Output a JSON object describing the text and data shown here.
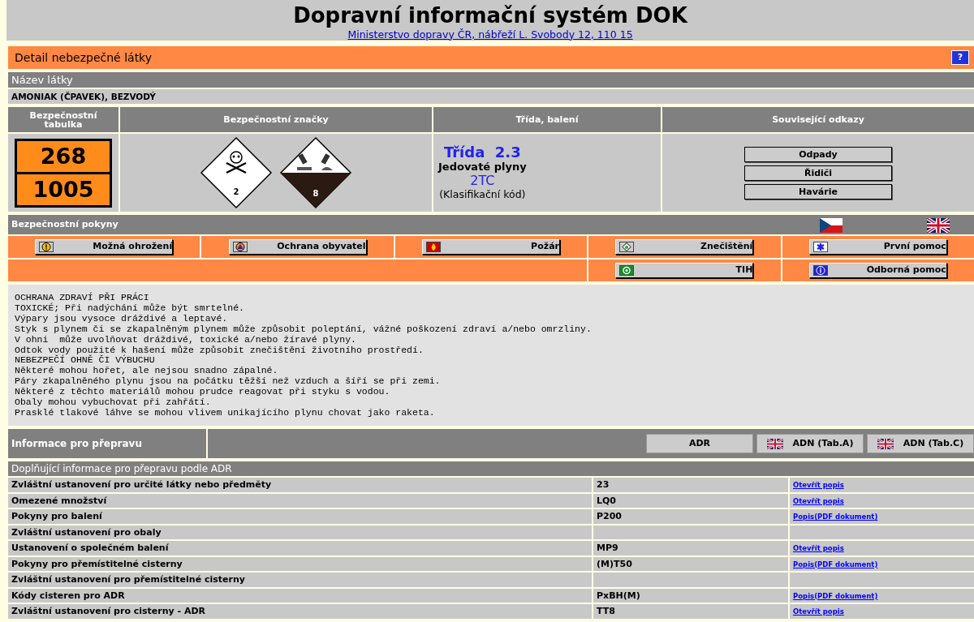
{
  "header": {
    "title": "Dopravní informační systém DOK",
    "address_link": "Ministerstvo dopravy ČR, nábřeží L. Svobody 12, 110 15"
  },
  "detail": {
    "title": "Detail nebezpečné látky",
    "help_button": "?"
  },
  "substance": {
    "label": "Název látky",
    "name": "AMONIAK (ČPAVEK), BEZVODÝ"
  },
  "summary": {
    "columns": [
      "Bezpečnostní tabulka",
      "Bezpečnostní značky",
      "Třída, balení",
      "Související odkazy"
    ],
    "plate": {
      "hazard_number": "268",
      "un_number": "1005"
    },
    "hazard_labels": [
      {
        "kind": "toxic",
        "number": "2"
      },
      {
        "kind": "corrosive",
        "number": "8"
      }
    ],
    "class": {
      "title": "Třída  2.3",
      "description": "Jedovaté plyny",
      "code": "2TC",
      "code_label": "(Klasifikační kód)"
    },
    "links": [
      "Odpady",
      "Řidiči",
      "Havárie"
    ]
  },
  "safety": {
    "title": "Bezpečnostní pokyny",
    "button_rows": [
      [
        {
          "label": "Možná ohrožení",
          "kind": "warning"
        },
        {
          "label": "Ochrana obyvatel",
          "kind": "civil"
        },
        {
          "label": "Požár",
          "kind": "fire"
        },
        {
          "label": "Znečištění",
          "kind": "pollution"
        },
        {
          "label": "První pomoc",
          "kind": "firstaid"
        }
      ],
      [
        {
          "label": "TIH",
          "kind": "tih"
        },
        {
          "label": "Odborná pomoc",
          "kind": "info"
        }
      ]
    ],
    "text_lines": [
      "OCHRANA ZDRAVÍ PŘI PRÁCI",
      "TOXICKÉ; Při nadýchání může být smrtelné.",
      "Výpary jsou vysoce dráždivé a leptavé.",
      "Styk s plynem či se zkapalněným plynem může způsobit poleptání, vážné poškození zdraví a/nebo omrzliny.",
      "V ohni  může uvolňovat dráždivé, toxické a/nebo žíravé plyny.",
      "Odtok vody použité k hašení může způsobit znečištění životního prostředí.",
      "NEBEZPEČÍ OHNĚ ČI VÝBUCHU",
      "Některé mohou hořet, ale nejsou snadno zápalné.",
      "Páry zkapalněného plynu jsou na počátku těžší než vzduch a šíří se při zemi.",
      "Některé z těchto materiálů mohou prudce reagovat při styku s vodou.",
      "Obaly mohou vybuchovat při zahřátí.",
      "Prasklé tlakové láhve se mohou vlivem unikajícího plynu chovat jako raketa."
    ]
  },
  "transport": {
    "title": "Informace pro přepravu",
    "tabs": [
      {
        "label": "ADR",
        "flag": false
      },
      {
        "label": "ADN (Tab.A)",
        "flag": true
      },
      {
        "label": "ADN (Tab.C)",
        "flag": true
      }
    ]
  },
  "adr": {
    "title": "Doplňující informace pro přepravu podle ADR",
    "rows": [
      {
        "name": "Zvláštní ustanovení pro určité látky nebo předměty",
        "value": "23",
        "link": "Otevřít popis"
      },
      {
        "name": "Omezené množství",
        "value": "LQ0",
        "link": "Otevřít popis"
      },
      {
        "name": "Pokyny pro balení",
        "value": "P200",
        "link": "Popis(PDF dokument)"
      },
      {
        "name": "Zvláštní ustanovení pro obaly"
      },
      {
        "name": "Ustanovení o společném balení",
        "value": "MP9",
        "link": "Otevřít popis"
      },
      {
        "name": "Pokyny pro přemístitelné cisterny",
        "value": "(M)T50",
        "link": "Popis(PDF dokument)"
      },
      {
        "name": "Zvláštní ustanovení pro přemístitelné cisterny"
      },
      {
        "name": "Kódy cisteren pro ADR",
        "value": "PxBH(M)",
        "link": "Popis(PDF dokument)"
      },
      {
        "name": "Zvláštní ustanovení pro cisterny - ADR",
        "value": "TT8",
        "link": "Otevřít popis"
      }
    ]
  }
}
